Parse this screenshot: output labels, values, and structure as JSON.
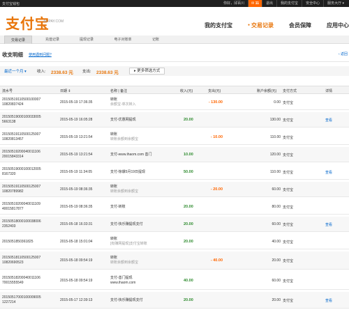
{
  "topbar": {
    "left_text": "支付宝钱包",
    "greeting": "你好，邱百川",
    "messages_label": "11",
    "logout": "退出",
    "my_alipay": "我的支付宝",
    "security": "安全中心",
    "service": "服务大厅"
  },
  "header": {
    "logo": "支付宝",
    "logo_sub": "ALIPAY.COM",
    "nav": [
      "我的支付宝",
      "交易记录",
      "会员保障",
      "应用中心"
    ]
  },
  "tabs": [
    "交易记录",
    "充值记录",
    "提现记录",
    "电子对账单",
    "记账"
  ],
  "page": {
    "title": "收支明细",
    "help": "使用遇到问题?",
    "back": "‹ 返回"
  },
  "filter": {
    "range": "最近一个月 ▾",
    "income_label": "收入:",
    "income": "2338.63 元",
    "expense_label": "支出:",
    "expense": "2338.63 元",
    "more_button": "更多筛选方式"
  },
  "columns": [
    "流水号",
    "日期 ⇕",
    "名称 | 备注",
    "收入(元)",
    "支出(元)",
    "账户余额(元)",
    "支付方式",
    "详情"
  ],
  "rows": [
    {
      "id1": "20150519110500100007",
      "id2": "10820837424",
      "date": "2015-05-19 17:36:35",
      "name": "转账",
      "sub": "余额宝-单次转入",
      "in": "",
      "out": "- 130.00",
      "bal": "0.00",
      "way": "支付宝",
      "act": ""
    },
    {
      "id1": "20150519000100033005",
      "id2": "5663138",
      "date": "2015-05-19 16:05:28",
      "name": "支付-优惠网提现",
      "sub": "",
      "in": "20.00",
      "out": "",
      "bal": "130.00",
      "way": "支付宝",
      "act": "查看"
    },
    {
      "id1": "20150519110500125007",
      "id2": "10820813457",
      "date": "2015-05-19 13:21:54",
      "name": "转账",
      "sub": "转账余额到余额宝",
      "in": "",
      "out": "- 10.00",
      "bal": "110.00",
      "way": "支付宝",
      "act": ""
    },
    {
      "id1": "20150519200040011106",
      "id2": "20015843314",
      "date": "2015-05-19 13:21:54",
      "name": "支付-www.ihaom.com 善门",
      "sub": "",
      "in": "10.00",
      "out": "",
      "bal": "120.00",
      "way": "支付宝",
      "act": ""
    },
    {
      "id1": "20150519000100012005",
      "id2": "8167320",
      "date": "2015-05-19 11:34:05",
      "name": "支付-惊爆5月19日提现",
      "sub": "",
      "in": "50.00",
      "out": "",
      "bal": "110.00",
      "way": "支付宝",
      "act": "查看"
    },
    {
      "id1": "20150519110500125007",
      "id2": "10820789982",
      "date": "2015-05-19 08:36:35",
      "name": "转账",
      "sub": "转账余额到余额宝",
      "in": "",
      "out": "- 20.00",
      "bal": "60.00",
      "way": "支付宝",
      "act": ""
    },
    {
      "id1": "20150519200040011109",
      "id2": "40015817877",
      "date": "2015-05-19 08:36:35",
      "name": "支付-转账",
      "sub": "",
      "in": "20.00",
      "out": "",
      "bal": "80.00",
      "way": "支付宝",
      "act": ""
    },
    {
      "id1": "20150518000100038006",
      "id2": "2352403",
      "date": "2015-05-18 16:33:31",
      "name": "支付-快乐赚提现支付",
      "sub": "",
      "in": "20.00",
      "out": "",
      "bal": "60.00",
      "way": "支付宝",
      "act": "查看"
    },
    {
      "id1": "2015051850361825",
      "id2": "",
      "date": "2015-05-18 15:01:04",
      "name": "转账",
      "sub": "[有赚网提现]支付宝转账",
      "in": "20.00",
      "out": "",
      "bal": "40.00",
      "way": "支付宝",
      "act": ""
    },
    {
      "id1": "20150518110500125007",
      "id2": "10820690523",
      "date": "2015-05-18 09:54:19",
      "name": "转账",
      "sub": "转账余额到余额宝",
      "in": "",
      "out": "- 40.00",
      "bal": "20.00",
      "way": "支付宝",
      "act": ""
    },
    {
      "id1": "20150518200040011106",
      "id2": "70015555549",
      "date": "2015-05-18 09:54:19",
      "name": "支付-善门提现",
      "sub": "www.ihaom.com",
      "in": "40.00",
      "out": "",
      "bal": "60.00",
      "way": "支付宝",
      "act": ""
    },
    {
      "id1": "20150517000100009005",
      "id2": "1227214",
      "date": "2015-05-17 12:39:13",
      "name": "支付-快乐赚提现支付",
      "sub": "",
      "in": "20.00",
      "out": "",
      "bal": "20.00",
      "way": "支付宝",
      "act": "查看"
    }
  ]
}
